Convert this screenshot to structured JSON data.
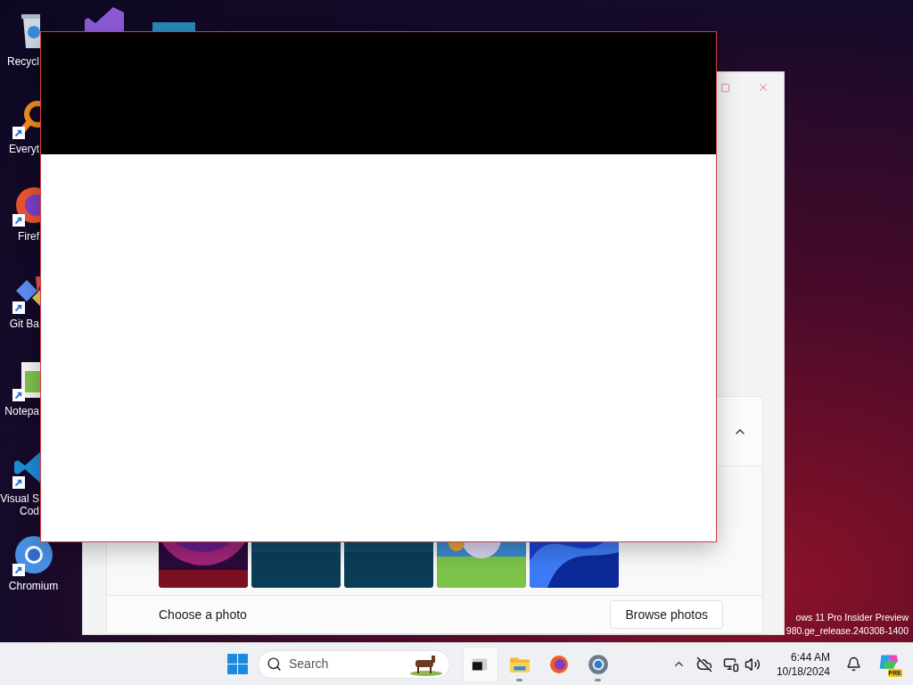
{
  "desktop_icons": [
    {
      "lines": [
        "Recycl"
      ],
      "shortcut": false
    },
    {
      "lines": [
        "Everyt"
      ],
      "shortcut": true
    },
    {
      "lines": [
        "Firef"
      ],
      "shortcut": true
    },
    {
      "lines": [
        "Git Ba"
      ],
      "shortcut": true
    },
    {
      "lines": [
        "Notepa"
      ],
      "shortcut": true
    },
    {
      "lines": [
        "Visual S",
        "Cod"
      ],
      "shortcut": true
    },
    {
      "lines": [
        "Chromium"
      ],
      "shortcut": true
    }
  ],
  "settings_window": {
    "expander": {
      "expanded": true
    },
    "choose_label": "Choose a photo",
    "browse_button": "Browse photos"
  },
  "build_watermark": [
    "ows 11 Pro Insider Preview",
    "980.ge_release.240308-1400"
  ],
  "taskbar": {
    "search": {
      "placeholder": "Search"
    },
    "apps": [
      {
        "selected": true,
        "running": false
      },
      {
        "selected": false,
        "running": true
      },
      {
        "selected": false,
        "running": false
      },
      {
        "selected": false,
        "running": true
      }
    ],
    "time": "6:44 AM",
    "date": "10/18/2024",
    "copilot_badge": "PRE"
  }
}
